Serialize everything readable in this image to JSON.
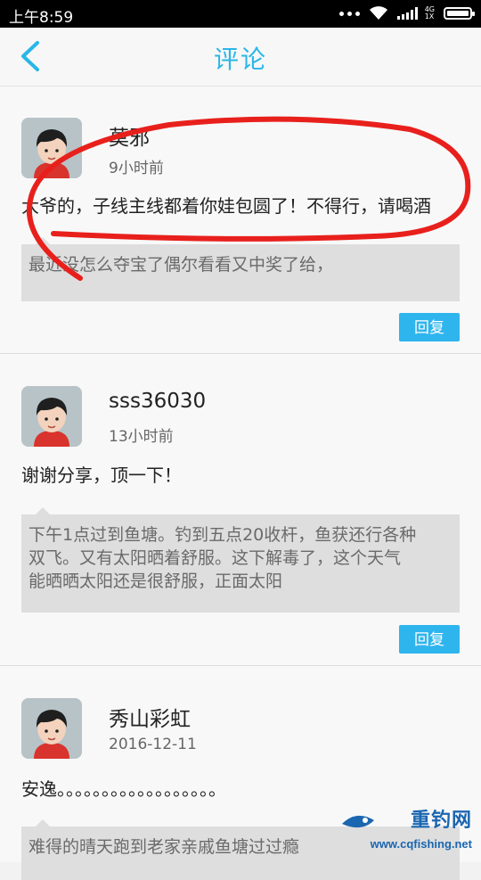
{
  "status_bar": {
    "time": "上午8:59",
    "network": "4G",
    "network_sub": "1X"
  },
  "header": {
    "title": "评论"
  },
  "comments": [
    {
      "username": "莫邪",
      "time": "9小时前",
      "text": "大爷的，子线主线都着你娃包圆了！不得行，请喝酒",
      "quote_lines": [
        "最近没怎么夺宝了偶尔看看又中奖了给，"
      ],
      "reply_label": "回复"
    },
    {
      "username": "sss36030",
      "time": "13小时前",
      "text": "谢谢分享，顶一下！",
      "quote_lines": [
        "下午1点过到鱼塘。钓到五点20收杆，鱼获还行各种",
        "双飞。又有太阳晒着舒服。这下解毒了，这个天气",
        "能晒晒太阳还是很舒服，正面太阳"
      ],
      "reply_label": "回复"
    },
    {
      "username": "秀山彩虹",
      "time": "2016-12-11",
      "text": "安逸。。。。。。。。。。。。。。。。。。",
      "quote_lines": [
        "难得的晴天跑到老家亲戚鱼塘过过瘾"
      ]
    }
  ],
  "watermark": {
    "brand": "重钓网",
    "url": "www.cqfishing.net"
  },
  "colors": {
    "accent": "#29b6e8",
    "reply_button": "#2fb5ee",
    "annotation": "#e8201c"
  }
}
